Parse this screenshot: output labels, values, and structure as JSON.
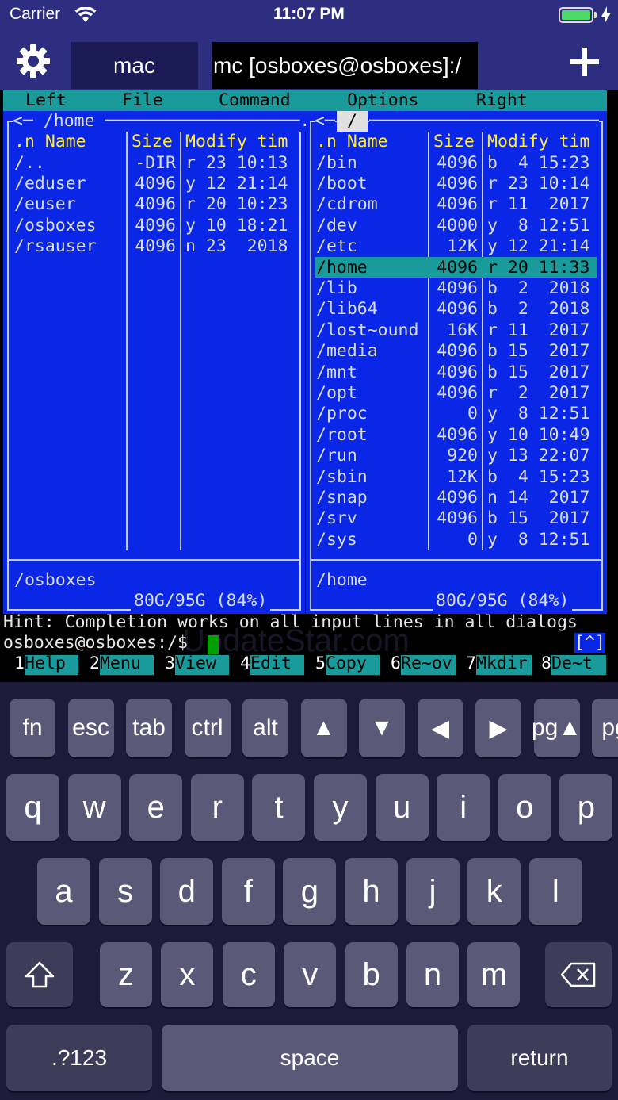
{
  "status_bar": {
    "carrier": "Carrier",
    "time": "11:07 PM"
  },
  "tabs": [
    {
      "label": "mac"
    },
    {
      "label": "mc [osboxes@osboxes]:/"
    }
  ],
  "menu": [
    "Left",
    "File",
    "Command",
    "Options",
    "Right"
  ],
  "left_panel": {
    "path_header": "<─ /home ───────────────────.[^]>",
    "columns": [
      ".n Name",
      "Size",
      "Modify tim"
    ],
    "rows": [
      {
        "name": "/..",
        "size": "-DIR",
        "modified": "r 23 10:13"
      },
      {
        "name": "/eduser",
        "size": "4096",
        "modified": "y 12 21:14"
      },
      {
        "name": "/euser",
        "size": "4096",
        "modified": "r 20 10:23"
      },
      {
        "name": "/osboxes",
        "size": "4096",
        "modified": "y 10 18:21"
      },
      {
        "name": "/rsauser",
        "size": "4096",
        "modified": "n 23  2018"
      }
    ],
    "status": "/osboxes",
    "disk": "80G/95G (84%)"
  },
  "right_panel": {
    "path_left": "<─",
    "path": "/",
    "path_right": "──────────────────────────.[^]>",
    "columns": [
      ".n Name",
      "Size",
      "Modify tim"
    ],
    "rows": [
      {
        "name": "/bin",
        "size": "4096",
        "modified": "b  4 15:23"
      },
      {
        "name": "/boot",
        "size": "4096",
        "modified": "r 23 10:14"
      },
      {
        "name": "/cdrom",
        "size": "4096",
        "modified": "r 11  2017"
      },
      {
        "name": "/dev",
        "size": "4000",
        "modified": "y  8 12:51"
      },
      {
        "name": "/etc",
        "size": "12K",
        "modified": "y 12 21:14"
      },
      {
        "name": "/home",
        "size": "4096",
        "modified": "r 20 11:33"
      },
      {
        "name": "/lib",
        "size": "4096",
        "modified": "b  2  2018"
      },
      {
        "name": "/lib64",
        "size": "4096",
        "modified": "b  2  2018"
      },
      {
        "name": "/lost~ound",
        "size": "16K",
        "modified": "r 11  2017"
      },
      {
        "name": "/media",
        "size": "4096",
        "modified": "b 15  2017"
      },
      {
        "name": "/mnt",
        "size": "4096",
        "modified": "b 15  2017"
      },
      {
        "name": "/opt",
        "size": "4096",
        "modified": "r  2  2017"
      },
      {
        "name": "/proc",
        "size": "0",
        "modified": "y  8 12:51"
      },
      {
        "name": "/root",
        "size": "4096",
        "modified": "y 10 10:49"
      },
      {
        "name": "/run",
        "size": "920",
        "modified": "y 13 22:07"
      },
      {
        "name": "/sbin",
        "size": "12K",
        "modified": "b  4 15:23"
      },
      {
        "name": "/snap",
        "size": "4096",
        "modified": "n 14  2017"
      },
      {
        "name": "/srv",
        "size": "4096",
        "modified": "b 15  2017"
      },
      {
        "name": "/sys",
        "size": "0",
        "modified": "y  8 12:51"
      }
    ],
    "selected_index": 5,
    "status": "/home",
    "disk": "80G/95G (84%)"
  },
  "hint": "Hint: Completion works on all input lines in all dialogs",
  "prompt": "osboxes@osboxes:/$ ",
  "prompt_indicator": "[^]",
  "function_keys": [
    {
      "num": "1",
      "label": "Help"
    },
    {
      "num": "2",
      "label": "Menu"
    },
    {
      "num": "3",
      "label": "View"
    },
    {
      "num": "4",
      "label": "Edit"
    },
    {
      "num": "5",
      "label": "Copy"
    },
    {
      "num": "6",
      "label": "Re~ov"
    },
    {
      "num": "7",
      "label": "Mkdir"
    },
    {
      "num": "8",
      "label": "De~t"
    }
  ],
  "watermark": "UpdateStar.com",
  "keyboard": {
    "extra_row": [
      "fn",
      "esc",
      "tab",
      "ctrl",
      "alt",
      "▲",
      "▼",
      "◀",
      "▶",
      "pg▲",
      "pg"
    ],
    "row1": [
      "q",
      "w",
      "e",
      "r",
      "t",
      "y",
      "u",
      "i",
      "o",
      "p"
    ],
    "row2": [
      "a",
      "s",
      "d",
      "f",
      "g",
      "h",
      "j",
      "k",
      "l"
    ],
    "row3": [
      "z",
      "x",
      "c",
      "v",
      "b",
      "n",
      "m"
    ],
    "numbers": ".?123",
    "space": "space",
    "return": "return"
  },
  "colors": {
    "panel": "#0a26e6",
    "menu": "#1a9b9b",
    "header_text": "#ffeb3b",
    "chrome": "#2e2e80"
  }
}
